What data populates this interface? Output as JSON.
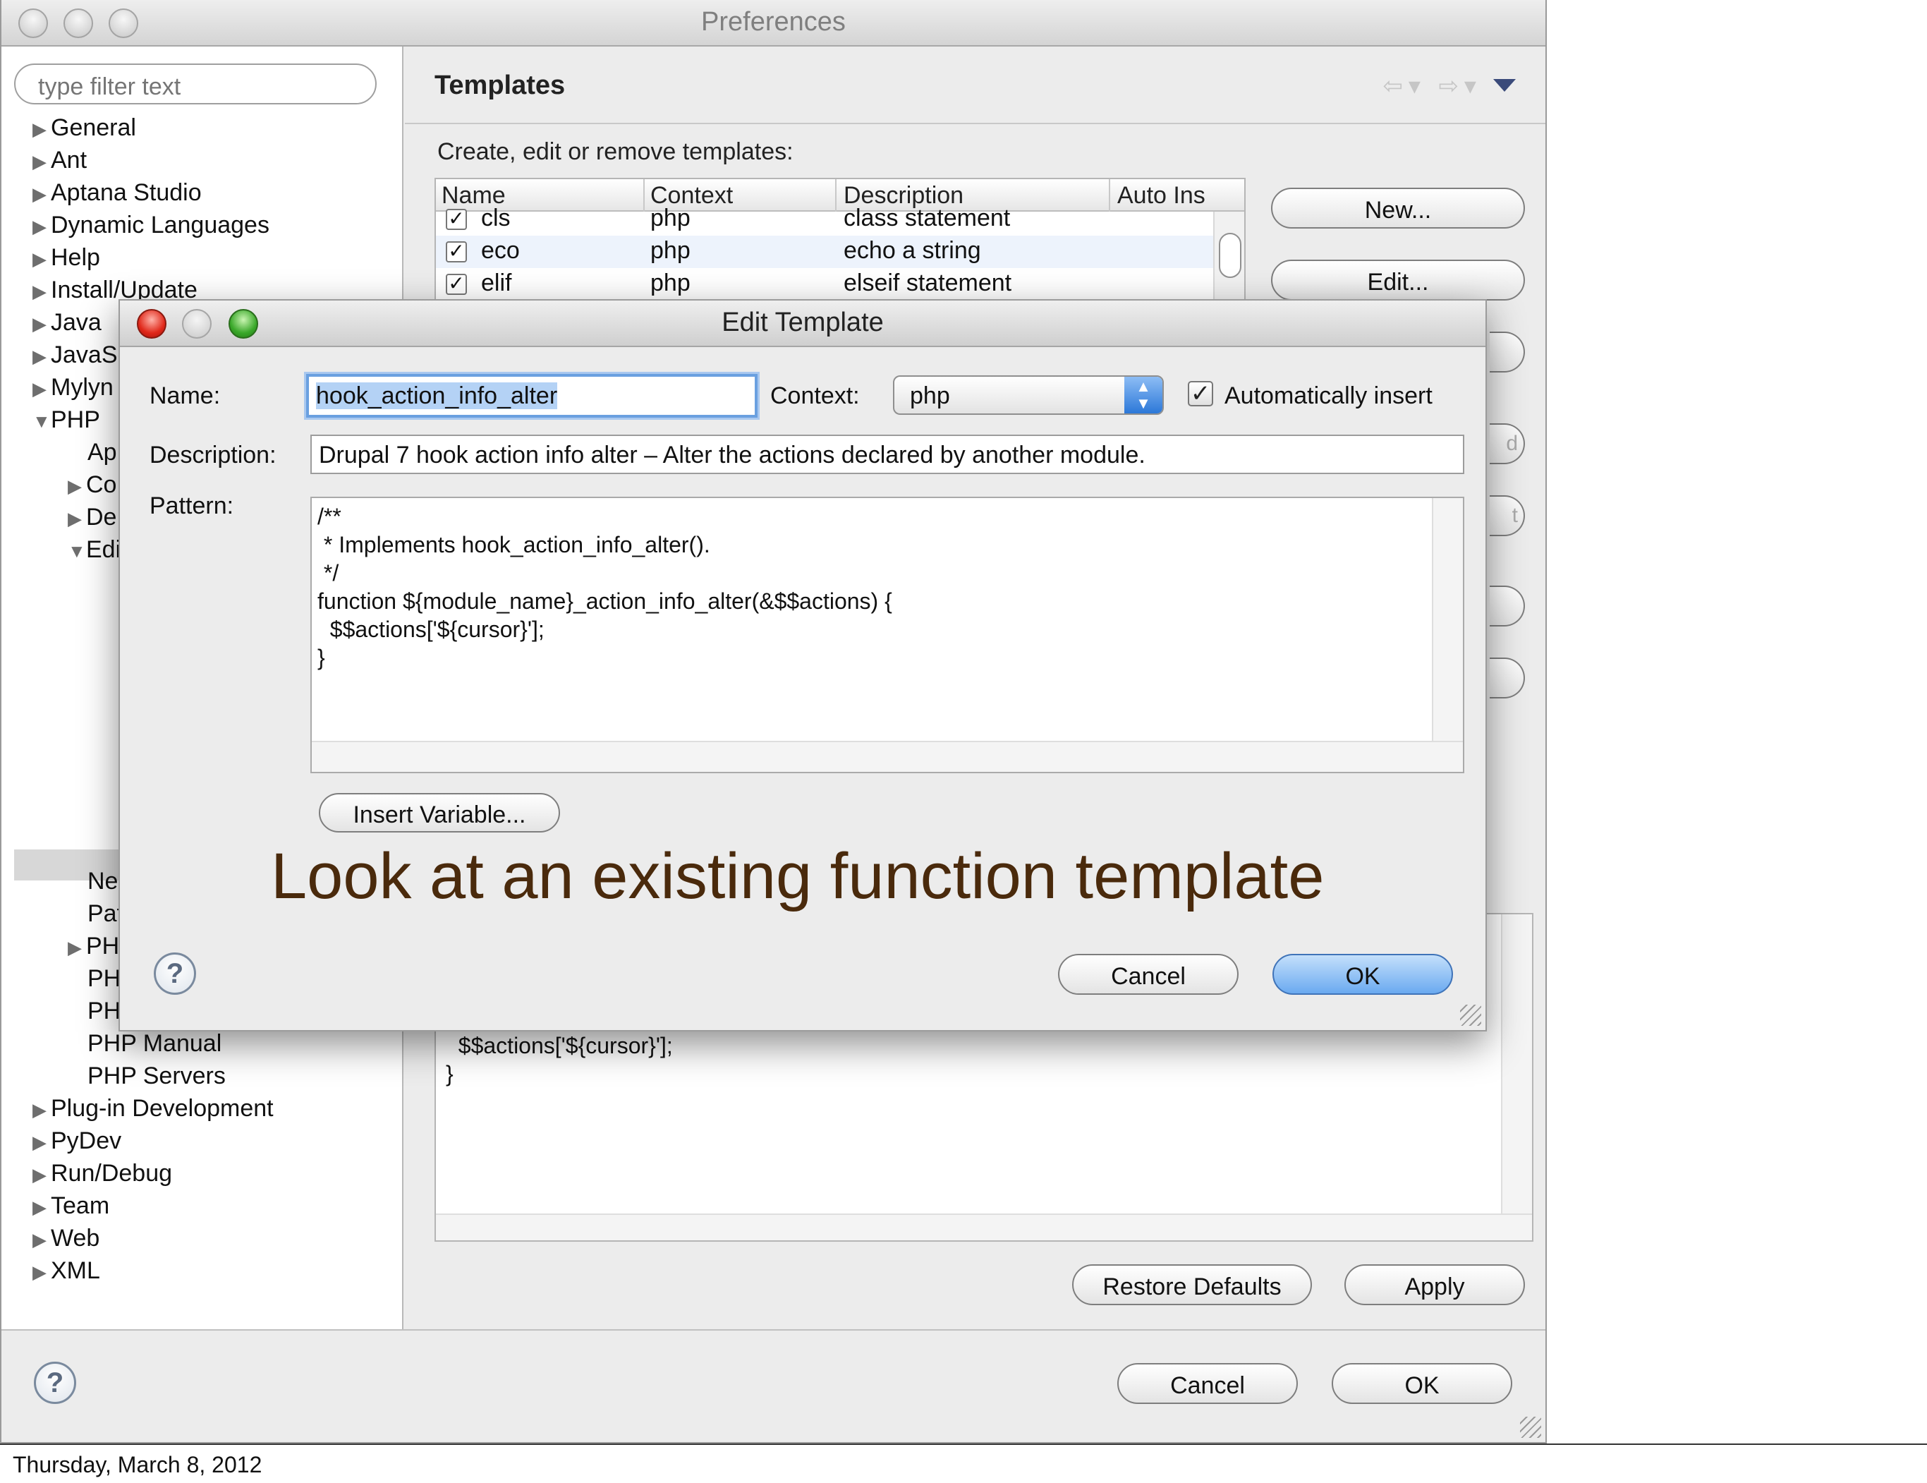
{
  "preferences": {
    "title": "Preferences",
    "filter_placeholder": "type filter text",
    "tree": {
      "general": "General",
      "ant": "Ant",
      "aptana": "Aptana Studio",
      "dynamic": "Dynamic Languages",
      "help": "Help",
      "install": "Install/Update",
      "java": "Java",
      "javascript": "JavaSc",
      "mylyn": "Mylyn",
      "php": "PHP",
      "php_ap": "Ap",
      "php_co": "Co",
      "php_de": "De",
      "php_edi": "Edi",
      "php_ne": "Ne",
      "php_pat": "Pat",
      "php_ph1": "PH",
      "php_ph2": "PH",
      "php_ph3": "PH",
      "php_manual": "PHP Manual",
      "php_servers": "PHP Servers",
      "plugin_dev": "Plug-in Development",
      "pydev": "PyDev",
      "run_debug": "Run/Debug",
      "team": "Team",
      "web": "Web",
      "xml": "XML"
    },
    "templates": {
      "heading": "Templates",
      "subtitle": "Create, edit or remove templates:",
      "columns": [
        "Name",
        "Context",
        "Description",
        "Auto Ins"
      ],
      "rows": [
        {
          "checked": true,
          "name": "cls",
          "context": "php",
          "description": "class statement"
        },
        {
          "checked": true,
          "name": "eco",
          "context": "php",
          "description": "echo a string"
        },
        {
          "checked": true,
          "name": "elif",
          "context": "php",
          "description": "elseif statement"
        }
      ],
      "new_button": "New...",
      "edit_button": "Edit...",
      "stub_d": "d",
      "stub_t": "t",
      "preview_code": "  $$actions['${cursor}'];\n}",
      "restore_defaults": "Restore Defaults",
      "apply": "Apply"
    },
    "cancel": "Cancel",
    "ok": "OK",
    "help_symbol": "?"
  },
  "dialog": {
    "title": "Edit Template",
    "name_label": "Name:",
    "name_value": "hook_action_info_alter",
    "context_label": "Context:",
    "context_value": "php",
    "auto_insert_label": "Automatically insert",
    "auto_insert_checked": true,
    "description_label": "Description:",
    "description_value": "Drupal 7 hook action info alter – Alter the actions declared by another module.",
    "pattern_label": "Pattern:",
    "pattern_code": "/**\n * Implements hook_action_info_alter().\n */\nfunction ${module_name}_action_info_alter(&$$actions) {\n  $$actions['${cursor}'];\n}",
    "insert_variable": "Insert Variable...",
    "cancel": "Cancel",
    "ok": "OK",
    "help_symbol": "?"
  },
  "overlay_caption": "Look at an existing function template",
  "footer_date": "Thursday, March 8, 2012",
  "colors": {
    "caption": "#4a2a0c",
    "default_button": "#6aaaf0",
    "selection": "#b4d2f5"
  }
}
